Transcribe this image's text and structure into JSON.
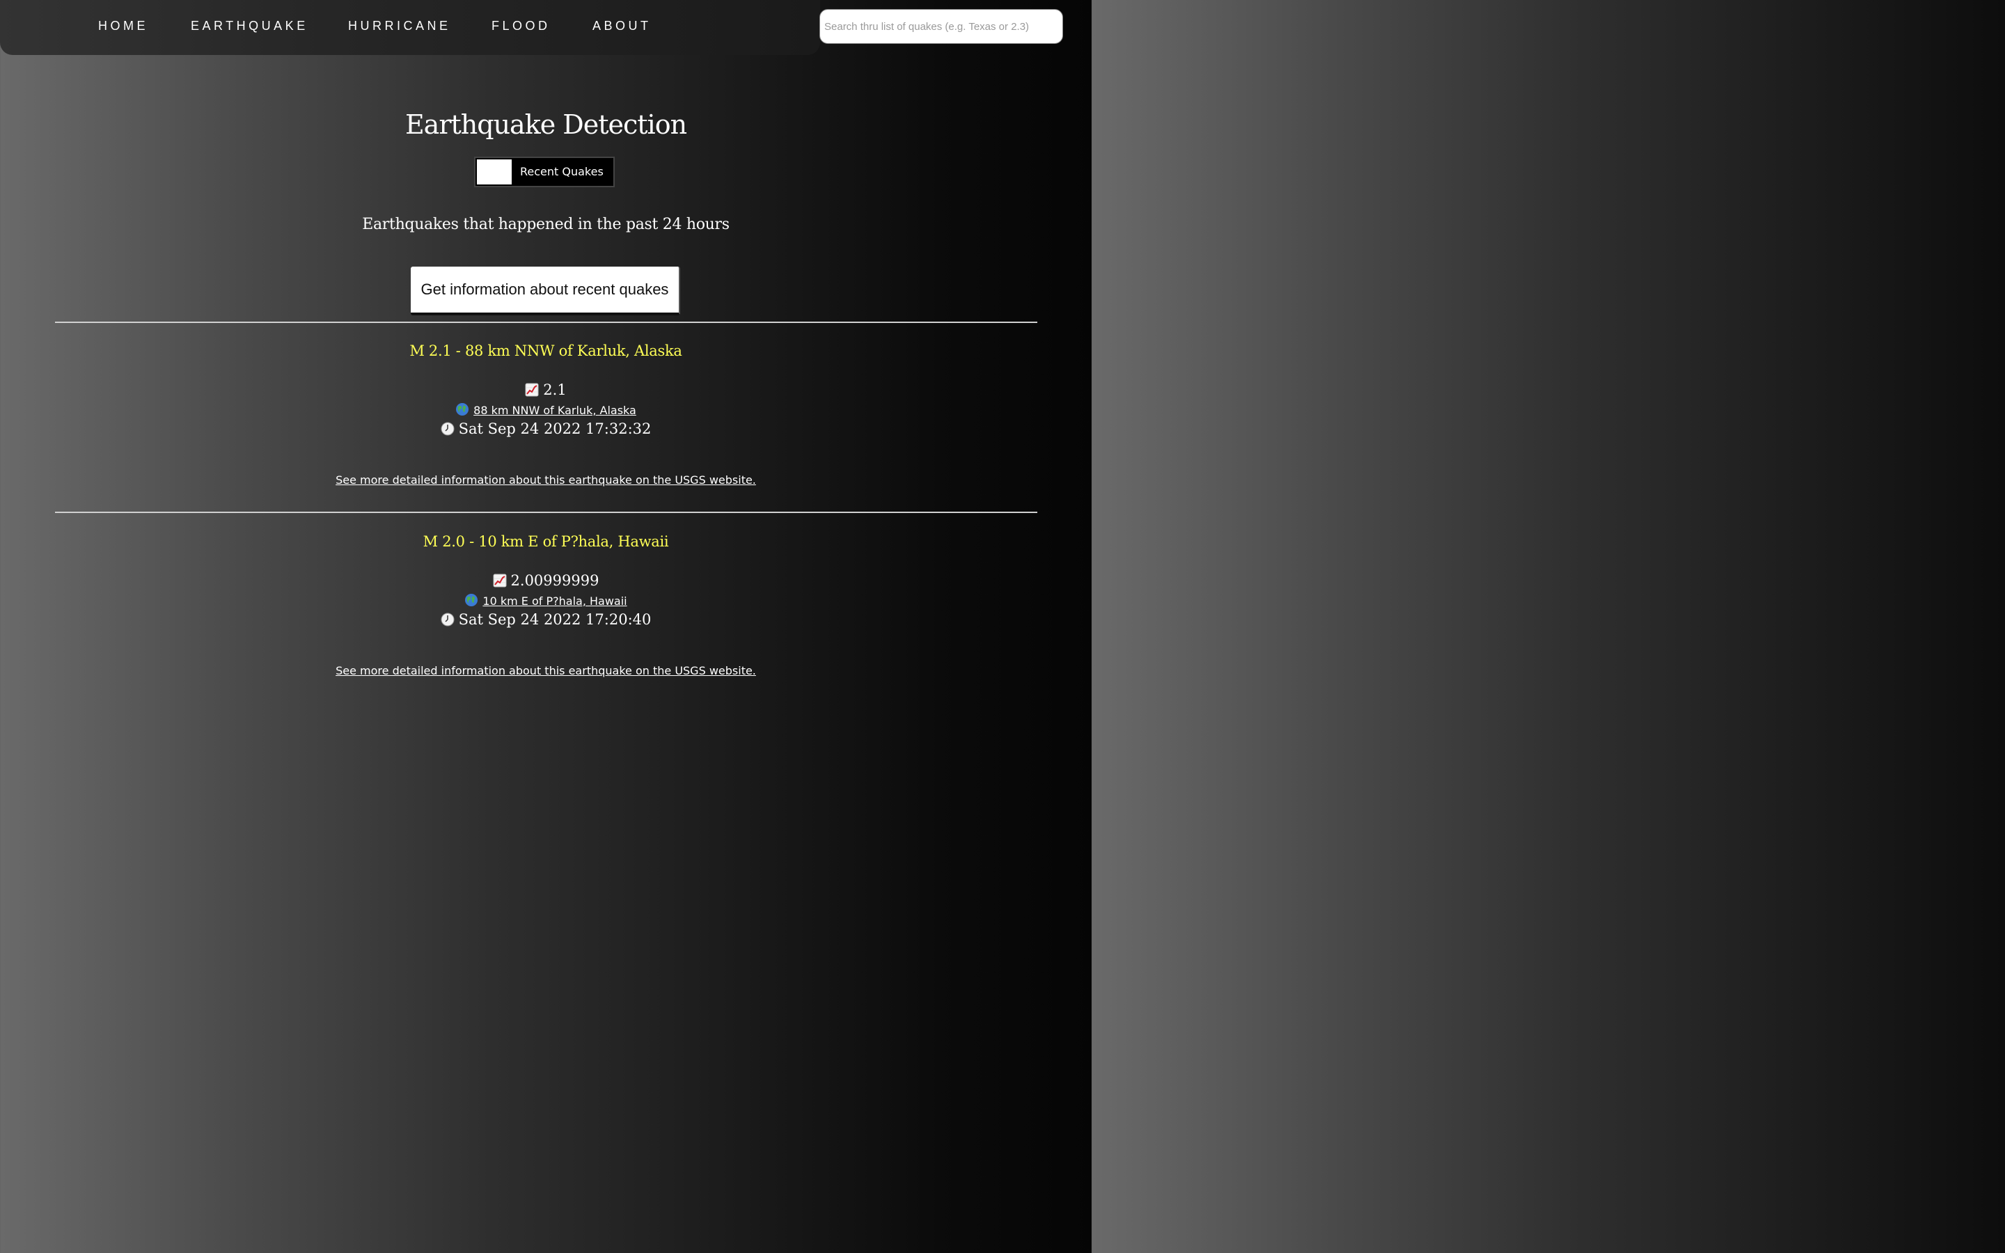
{
  "nav": {
    "items": [
      "HOME",
      "EARTHQUAKE",
      "HURRICANE",
      "FLOOD",
      "ABOUT"
    ],
    "search_placeholder": "Search thru list of quakes (e.g. Texas or 2.3)"
  },
  "page": {
    "title": "Earthquake Detection",
    "toggle_label": "Recent Quakes",
    "subtitle": "Earthquakes that happened in the past 24 hours",
    "get_info_label": "Get information about recent quakes"
  },
  "quakes": [
    {
      "title": "M 2.1 - 88 km NNW of Karluk, Alaska",
      "magnitude": "2.1",
      "place": "88 km NNW of Karluk, Alaska",
      "time": "Sat Sep 24 2022 17:32:32",
      "usgs_link_text": "See more detailed information about this earthquake on the USGS website."
    },
    {
      "title": "M 2.0 - 10 km E of P?hala, Hawaii",
      "magnitude": "2.00999999",
      "place": "10 km E of P?hala, Hawaii",
      "time": "Sat Sep 24 2022 17:20:40",
      "usgs_link_text": "See more detailed information about this earthquake on the USGS website."
    }
  ],
  "icons": {
    "magnitude": "chart-increasing-icon",
    "location": "globe-icon",
    "time": "clock-icon"
  },
  "colors": {
    "quake_title": "#ffff55",
    "background_left": "#6a6a6a",
    "background_right": "#050505"
  }
}
